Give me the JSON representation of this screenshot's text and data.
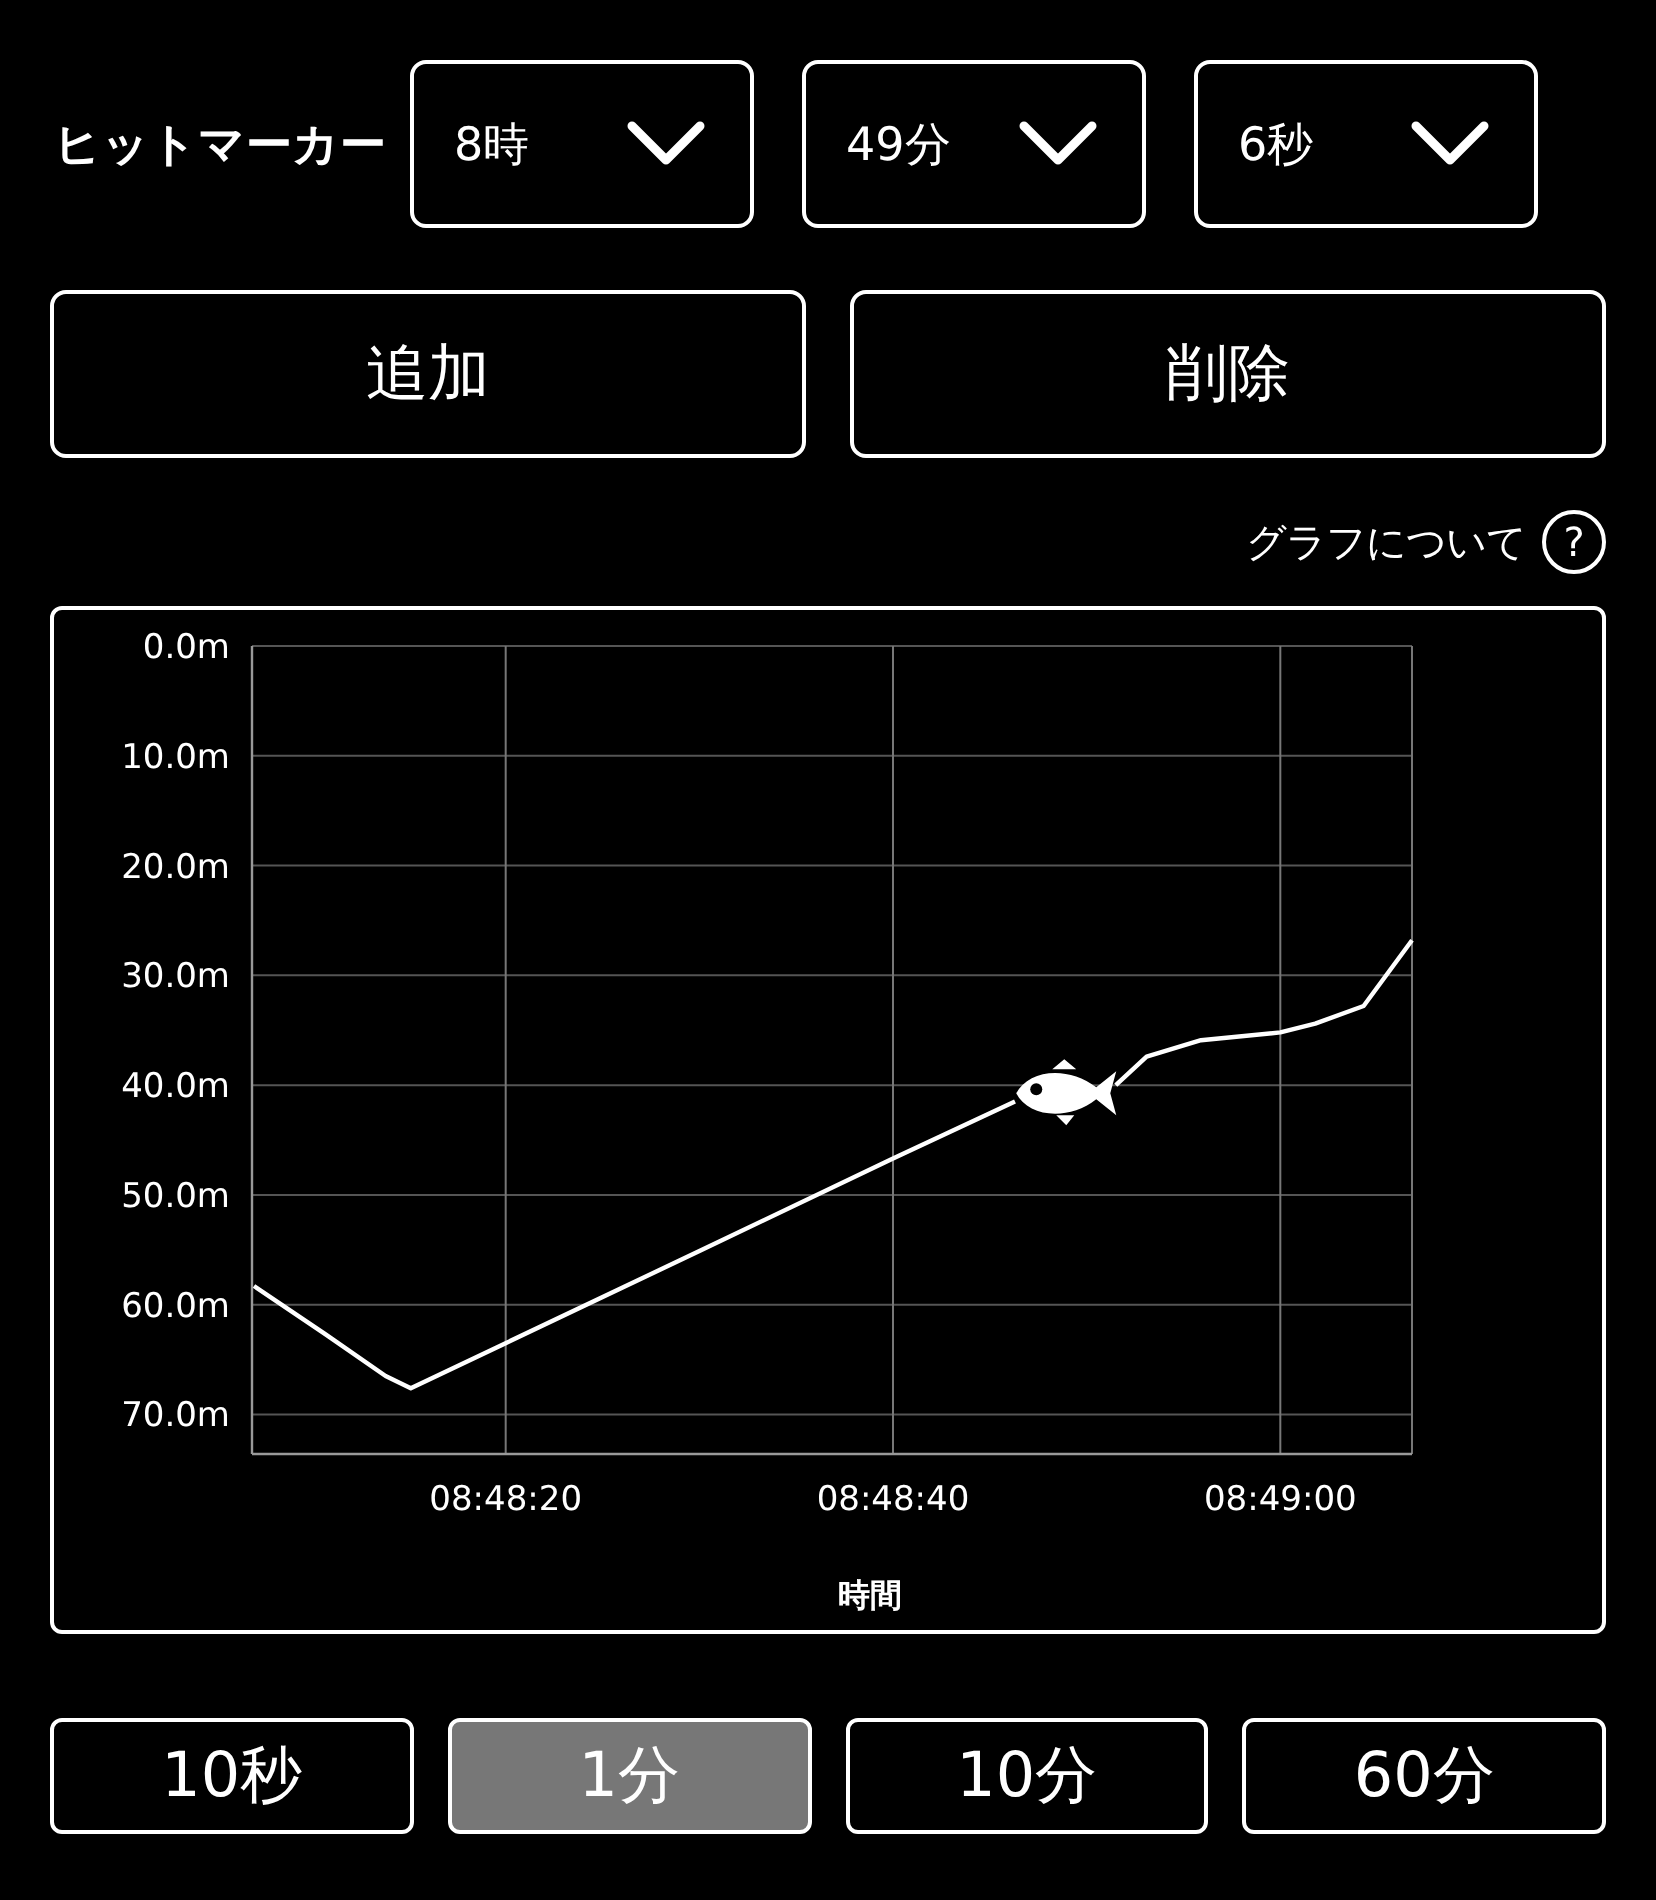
{
  "hit_marker": {
    "label": "ヒットマーカー",
    "selects": [
      {
        "value": "8時"
      },
      {
        "value": "49分"
      },
      {
        "value": "6秒"
      }
    ]
  },
  "actions": [
    {
      "label": "追加"
    },
    {
      "label": "削除"
    }
  ],
  "help_link": {
    "label": "グラフについて",
    "icon": "?"
  },
  "chart": {
    "chart_data": {
      "type": "line",
      "xlabel": "時間",
      "x": [
        31687,
        31690.7,
        31693.8,
        31695.1,
        31700,
        31710,
        31720,
        31726.3,
        31728.1,
        31730,
        31731.5,
        31733.1,
        31735.9,
        31740,
        31741.8,
        31744.3,
        31746.8
      ],
      "series": [
        {
          "color": "#ffffff",
          "values": [
            58.3,
            62.7,
            66.5,
            67.6,
            63.5,
            55.1,
            46.7,
            41.5,
            null,
            null,
            40,
            37.4,
            35.9,
            35.2,
            34.4,
            32.8,
            26.8
          ]
        }
      ],
      "grid": true,
      "xlim": [
        31686.9,
        31746.8
      ],
      "ylim": [
        73.6,
        0
      ],
      "xticks": [
        {
          "value": 31700,
          "label": "08:48:20"
        },
        {
          "value": 31720,
          "label": "08:48:40"
        },
        {
          "value": 31740,
          "label": "08:49:00"
        }
      ],
      "yticks": [
        {
          "value": 0,
          "label": "0.0m"
        },
        {
          "value": 10,
          "label": "10.0m"
        },
        {
          "value": 20,
          "label": "20.0m"
        },
        {
          "value": 30,
          "label": "30.0m"
        },
        {
          "value": 40,
          "label": "40.0m"
        },
        {
          "value": 50,
          "label": "50.0m"
        },
        {
          "value": 60,
          "label": "60.0m"
        },
        {
          "value": 70,
          "label": "70.0m"
        }
      ]
    }
  },
  "ranges": [
    {
      "label": "10秒",
      "selected": false
    },
    {
      "label": "1分",
      "selected": true
    },
    {
      "label": "10分",
      "selected": false
    },
    {
      "label": "60分",
      "selected": false
    }
  ]
}
